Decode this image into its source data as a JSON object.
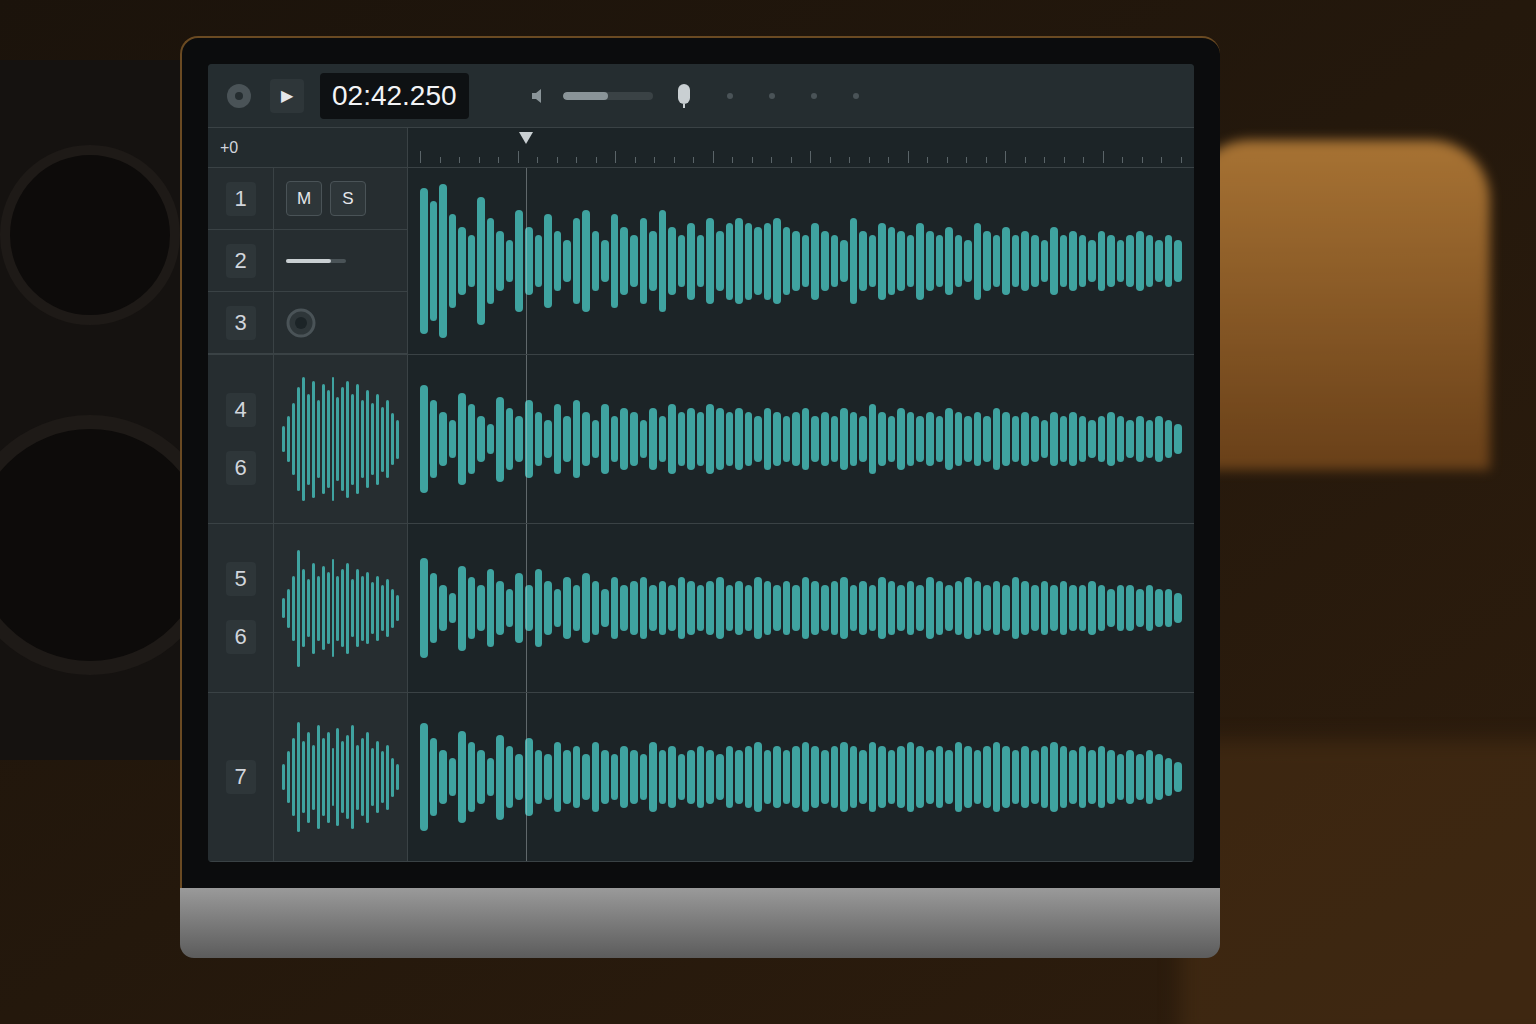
{
  "transport": {
    "play_icon": "▶",
    "time": "02:42.250",
    "volume": {
      "level": 0.5
    }
  },
  "ruler": {
    "offset": "+0",
    "playhead": {
      "level": 0.15
    }
  },
  "tracks": [
    {
      "numbers": [
        "1"
      ],
      "kind": "buttons",
      "buttons": [
        {
          "label": "M",
          "selected": false
        },
        {
          "label": "S",
          "selected": false
        }
      ]
    },
    {
      "numbers": [
        "2"
      ],
      "kind": "fader",
      "level": 0.75
    },
    {
      "numbers": [
        "3"
      ],
      "kind": "knob"
    },
    {
      "numbers": [
        "4",
        "6"
      ],
      "kind": "waveform",
      "wave": [
        0.2,
        0.35,
        0.55,
        0.8,
        0.95,
        0.7,
        0.9,
        0.6,
        0.85,
        0.75,
        0.95,
        0.65,
        0.8,
        0.9,
        0.7,
        0.85,
        0.6,
        0.75,
        0.55,
        0.7,
        0.5,
        0.6,
        0.4,
        0.3
      ]
    },
    {
      "numbers": [
        "5",
        "6"
      ],
      "kind": "waveform",
      "wave": [
        0.15,
        0.3,
        0.5,
        0.9,
        0.6,
        0.45,
        0.7,
        0.5,
        0.65,
        0.55,
        0.75,
        0.5,
        0.6,
        0.7,
        0.45,
        0.6,
        0.5,
        0.55,
        0.4,
        0.5,
        0.35,
        0.45,
        0.3,
        0.2
      ]
    },
    {
      "numbers": [
        "7"
      ],
      "kind": "waveform",
      "wave": [
        0.2,
        0.4,
        0.6,
        0.85,
        0.55,
        0.7,
        0.5,
        0.8,
        0.6,
        0.7,
        0.45,
        0.75,
        0.55,
        0.65,
        0.8,
        0.5,
        0.6,
        0.7,
        0.45,
        0.55,
        0.4,
        0.5,
        0.3,
        0.2
      ]
    }
  ],
  "lanes": [
    {
      "wave": [
        0.85,
        0.7,
        0.9,
        0.55,
        0.4,
        0.3,
        0.75,
        0.5,
        0.35,
        0.25,
        0.6,
        0.4,
        0.3,
        0.55,
        0.35,
        0.25,
        0.5,
        0.6,
        0.35,
        0.25,
        0.55,
        0.4,
        0.3,
        0.5,
        0.35,
        0.6,
        0.4,
        0.3,
        0.45,
        0.3,
        0.5,
        0.35,
        0.45,
        0.5,
        0.45,
        0.4,
        0.45,
        0.5,
        0.4,
        0.35,
        0.3,
        0.45,
        0.35,
        0.3,
        0.25,
        0.5,
        0.35,
        0.3,
        0.45,
        0.4,
        0.35,
        0.3,
        0.45,
        0.35,
        0.3,
        0.4,
        0.3,
        0.25,
        0.45,
        0.35,
        0.3,
        0.4,
        0.3,
        0.35,
        0.3,
        0.25,
        0.4,
        0.3,
        0.35,
        0.3,
        0.25,
        0.35,
        0.3,
        0.25,
        0.3,
        0.35,
        0.3,
        0.25,
        0.3,
        0.25
      ]
    },
    {
      "wave": [
        0.7,
        0.5,
        0.35,
        0.25,
        0.6,
        0.45,
        0.3,
        0.2,
        0.55,
        0.4,
        0.3,
        0.5,
        0.35,
        0.25,
        0.45,
        0.3,
        0.5,
        0.35,
        0.25,
        0.45,
        0.3,
        0.4,
        0.35,
        0.25,
        0.4,
        0.3,
        0.45,
        0.35,
        0.4,
        0.35,
        0.45,
        0.4,
        0.35,
        0.4,
        0.35,
        0.3,
        0.4,
        0.35,
        0.3,
        0.35,
        0.4,
        0.3,
        0.35,
        0.3,
        0.4,
        0.35,
        0.3,
        0.45,
        0.35,
        0.3,
        0.4,
        0.35,
        0.3,
        0.35,
        0.3,
        0.4,
        0.35,
        0.3,
        0.35,
        0.3,
        0.4,
        0.35,
        0.3,
        0.35,
        0.3,
        0.25,
        0.35,
        0.3,
        0.35,
        0.3,
        0.25,
        0.3,
        0.35,
        0.3,
        0.25,
        0.3,
        0.25,
        0.3,
        0.25,
        0.2
      ]
    },
    {
      "wave": [
        0.65,
        0.45,
        0.3,
        0.2,
        0.55,
        0.4,
        0.3,
        0.5,
        0.35,
        0.25,
        0.45,
        0.3,
        0.5,
        0.35,
        0.25,
        0.4,
        0.3,
        0.45,
        0.35,
        0.25,
        0.4,
        0.3,
        0.35,
        0.4,
        0.3,
        0.35,
        0.3,
        0.4,
        0.35,
        0.3,
        0.35,
        0.4,
        0.3,
        0.35,
        0.3,
        0.4,
        0.35,
        0.3,
        0.35,
        0.3,
        0.4,
        0.35,
        0.3,
        0.35,
        0.4,
        0.3,
        0.35,
        0.3,
        0.4,
        0.35,
        0.3,
        0.35,
        0.3,
        0.4,
        0.35,
        0.3,
        0.35,
        0.4,
        0.35,
        0.3,
        0.35,
        0.3,
        0.4,
        0.35,
        0.3,
        0.35,
        0.3,
        0.35,
        0.3,
        0.3,
        0.35,
        0.3,
        0.25,
        0.3,
        0.3,
        0.25,
        0.3,
        0.25,
        0.25,
        0.2
      ]
    },
    {
      "wave": [
        0.7,
        0.5,
        0.35,
        0.25,
        0.6,
        0.45,
        0.35,
        0.25,
        0.55,
        0.4,
        0.3,
        0.5,
        0.35,
        0.3,
        0.45,
        0.35,
        0.4,
        0.3,
        0.45,
        0.35,
        0.3,
        0.4,
        0.35,
        0.3,
        0.45,
        0.35,
        0.4,
        0.3,
        0.35,
        0.4,
        0.35,
        0.3,
        0.4,
        0.35,
        0.4,
        0.45,
        0.35,
        0.4,
        0.35,
        0.4,
        0.45,
        0.4,
        0.35,
        0.4,
        0.45,
        0.4,
        0.35,
        0.45,
        0.4,
        0.35,
        0.4,
        0.45,
        0.4,
        0.35,
        0.4,
        0.35,
        0.45,
        0.4,
        0.35,
        0.4,
        0.45,
        0.4,
        0.35,
        0.4,
        0.35,
        0.4,
        0.45,
        0.4,
        0.35,
        0.4,
        0.35,
        0.4,
        0.35,
        0.3,
        0.35,
        0.3,
        0.35,
        0.3,
        0.25,
        0.2
      ]
    }
  ]
}
